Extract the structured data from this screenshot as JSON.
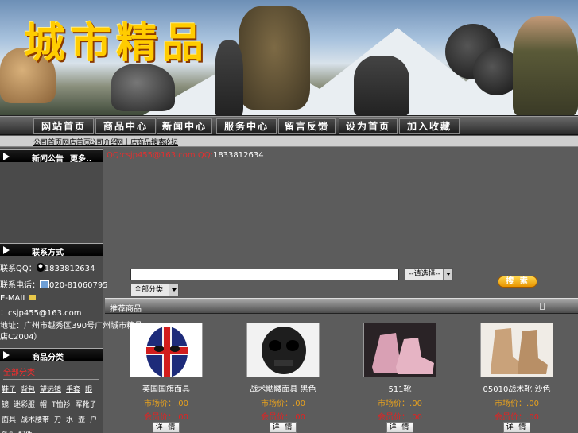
{
  "banner": {
    "logo_text": "城市精品"
  },
  "nav": {
    "items": [
      "网站首页",
      "商品中心",
      "新闻中心",
      "服务中心",
      "留言反馈",
      "设为首页",
      "加入收藏"
    ]
  },
  "subnav": {
    "items": [
      "公司首页",
      "网店首页",
      "公司介绍",
      "网上店",
      "商品搜索",
      "论坛"
    ]
  },
  "left": {
    "panel1_title": "新闻公告",
    "panel1_more": "更多..",
    "panel2_title": "联系方式",
    "qq_label": "联系QQ：",
    "qq_value": "1833812634",
    "phone_label": "联系电话：",
    "phone_value": "020-81060795",
    "email_label": "E-MAIL",
    "email_value": "：csjp455@163.com",
    "address": "地址：广州市越秀区390号广州城市精品",
    "address2": "店C2004）",
    "panel3_title": "商品分类",
    "category_selected": "全部分类",
    "categories": [
      "鞋子",
      "背包",
      "望远镜",
      "手套",
      "眼镜",
      "迷彩服",
      "帽",
      "T恤衫",
      "军靴子",
      "面具",
      "战术腰带",
      "刀",
      "水",
      "壶",
      "户外S",
      "配件"
    ]
  },
  "main": {
    "contact_red": "QQ:csjp455@163.com QQ:",
    "contact_white": "1833812634",
    "search_placeholder": "",
    "search_select1": "--请选择--",
    "search_select2": "全部分类",
    "search_button": "搜 索",
    "products_title": "推荐商品"
  },
  "products": [
    {
      "name": "英国国旗面具",
      "price1": "市场价：.00",
      "price2": "会员价：.00",
      "detail": "详 情"
    },
    {
      "name": "战术骷髅面具 黑色",
      "price1": "市场价：.00",
      "price2": "会员价：.00",
      "detail": "详 情"
    },
    {
      "name": "511靴",
      "price1": "市场价：.00",
      "price2": "会员价：.00",
      "detail": "详 情"
    },
    {
      "name": "05010战术靴 沙色",
      "price1": "市场价：.00",
      "price2": "会员价：.00",
      "detail": "详 情"
    }
  ],
  "colors": {
    "accent_red": "#e03030",
    "price_gold": "#e8a21e",
    "nav_dark": "#1c1c1c"
  }
}
